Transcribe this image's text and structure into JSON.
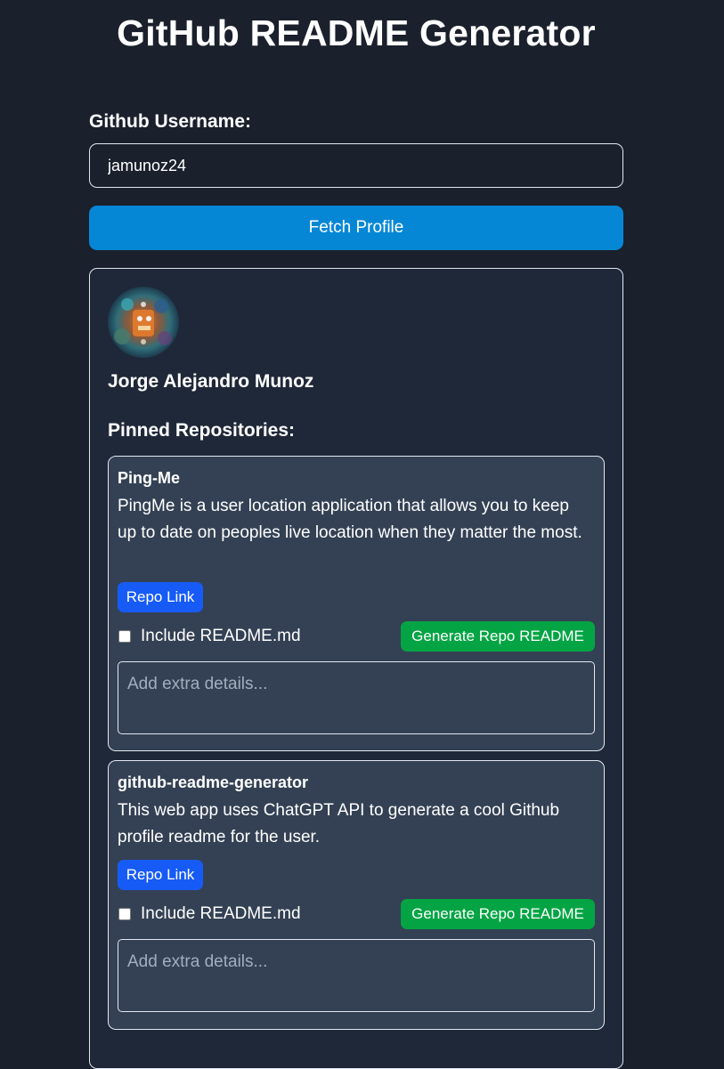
{
  "header": {
    "title": "GitHub README Generator"
  },
  "form": {
    "username_label": "Github Username:",
    "username_value": "jamunoz24",
    "fetch_button_label": "Fetch Profile"
  },
  "profile": {
    "name": "Jorge Alejandro Munoz",
    "pinned_heading": "Pinned Repositories:",
    "repos": [
      {
        "name": "Ping-Me",
        "description": "PingMe is a user location application that allows you to keep up to date on peoples live location when they matter the most.",
        "link_label": "Repo Link",
        "include_label": "Include README.md",
        "include_checked": false,
        "generate_label": "Generate Repo README",
        "details_placeholder": "Add extra details..."
      },
      {
        "name": "github-readme-generator",
        "description": "This web app uses ChatGPT API to generate a cool Github profile readme for the user.",
        "link_label": "Repo Link",
        "include_label": "Include README.md",
        "include_checked": false,
        "generate_label": "Generate Repo README",
        "details_placeholder": "Add extra details..."
      }
    ]
  },
  "colors": {
    "background": "#1a202c",
    "card_background": "#1f2838",
    "repo_card_background": "#344154",
    "fetch_button": "#0687d6",
    "repo_link_button": "#175bf6",
    "generate_button": "#04a444"
  }
}
